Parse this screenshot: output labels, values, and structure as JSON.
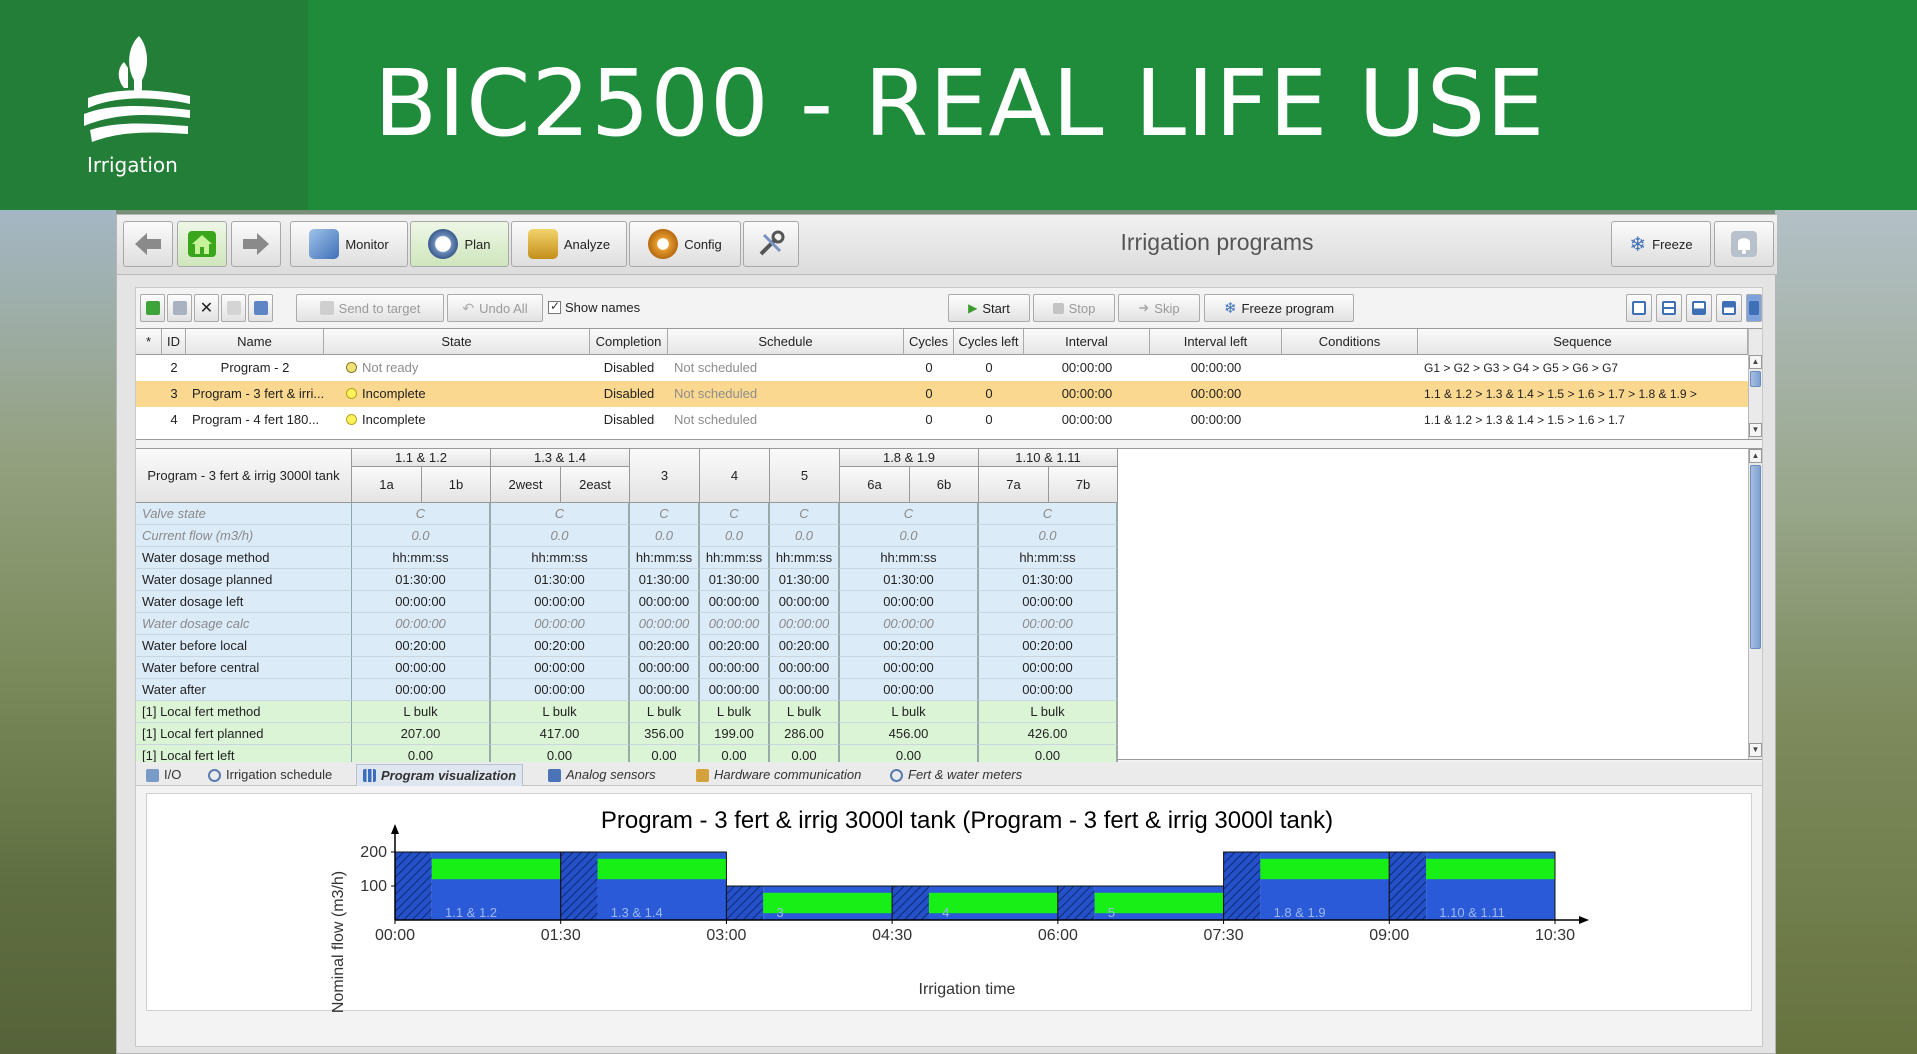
{
  "slide": {
    "title": "BIC2500 - REAL LIFE USE",
    "logo_text": "Irrigation"
  },
  "topbar": {
    "buttons": {
      "monitor": "Monitor",
      "plan": "Plan",
      "analyze": "Analyze",
      "config": "Config"
    },
    "page_title": "Irrigation programs",
    "freeze": "Freeze"
  },
  "toolbar": {
    "send_to_target": "Send to target",
    "undo_all": "Undo All",
    "show_names": "Show names",
    "start": "Start",
    "stop": "Stop",
    "skip": "Skip",
    "freeze_program": "Freeze program"
  },
  "programs": {
    "columns": [
      "*",
      "ID",
      "Name",
      "State",
      "Completion",
      "Schedule",
      "Cycles",
      "Cycles left",
      "Interval",
      "Interval left",
      "Conditions",
      "Sequence"
    ],
    "rows": [
      {
        "id": "2",
        "name": "Program - 2",
        "state": "Not ready",
        "completion": "Disabled",
        "schedule": "Not scheduled",
        "cycles": "0",
        "cycles_left": "0",
        "interval": "00:00:00",
        "interval_left": "00:00:00",
        "conditions": "",
        "sequence": "G1 > G2 > G3 > G4 > G5 > G6 > G7",
        "selected": false
      },
      {
        "id": "3",
        "name": "Program - 3 fert & irri...",
        "state": "Incomplete",
        "completion": "Disabled",
        "schedule": "Not scheduled",
        "cycles": "0",
        "cycles_left": "0",
        "interval": "00:00:00",
        "interval_left": "00:00:00",
        "conditions": "",
        "sequence": "1.1 & 1.2 > 1.3 & 1.4 > 1.5 > 1.6 > 1.7 > 1.8 & 1.9 >",
        "selected": true
      },
      {
        "id": "4",
        "name": "Program - 4 fert 180...",
        "state": "Incomplete",
        "completion": "Disabled",
        "schedule": "Not scheduled",
        "cycles": "0",
        "cycles_left": "0",
        "interval": "00:00:00",
        "interval_left": "00:00:00",
        "conditions": "",
        "sequence": "1.1 & 1.2 > 1.3 & 1.4 > 1.5 > 1.6 > 1.7",
        "selected": false
      }
    ]
  },
  "valve_grid": {
    "program_label": "Program - 3 fert & irrig 3000l tank",
    "groups": [
      "1.1 & 1.2",
      "1.3 & 1.4",
      "3",
      "4",
      "5",
      "1.8 & 1.9",
      "1.10 & 1.11"
    ],
    "subs": [
      "1a",
      "1b",
      "2west",
      "2east",
      "6a",
      "6b",
      "7a",
      "7b"
    ],
    "rows": [
      {
        "label": "Valve state",
        "values": [
          "C",
          "C",
          "C",
          "C",
          "C",
          "C",
          "C"
        ],
        "style": "blue",
        "italic": true
      },
      {
        "label": "Current flow (m3/h)",
        "values": [
          "0.0",
          "0.0",
          "0.0",
          "0.0",
          "0.0",
          "0.0",
          "0.0"
        ],
        "style": "blue",
        "italic": true
      },
      {
        "label": "Water dosage method",
        "values": [
          "hh:mm:ss",
          "hh:mm:ss",
          "hh:mm:ss",
          "hh:mm:ss",
          "hh:mm:ss",
          "hh:mm:ss",
          "hh:mm:ss"
        ],
        "style": "blue",
        "italic": false
      },
      {
        "label": "Water dosage planned",
        "values": [
          "01:30:00",
          "01:30:00",
          "01:30:00",
          "01:30:00",
          "01:30:00",
          "01:30:00",
          "01:30:00"
        ],
        "style": "blue",
        "italic": false
      },
      {
        "label": "Water dosage left",
        "values": [
          "00:00:00",
          "00:00:00",
          "00:00:00",
          "00:00:00",
          "00:00:00",
          "00:00:00",
          "00:00:00"
        ],
        "style": "blue",
        "italic": false
      },
      {
        "label": "Water dosage calc",
        "values": [
          "00:00:00",
          "00:00:00",
          "00:00:00",
          "00:00:00",
          "00:00:00",
          "00:00:00",
          "00:00:00"
        ],
        "style": "blue",
        "italic": true
      },
      {
        "label": "Water before local",
        "values": [
          "00:20:00",
          "00:20:00",
          "00:20:00",
          "00:20:00",
          "00:20:00",
          "00:20:00",
          "00:20:00"
        ],
        "style": "blue",
        "italic": false
      },
      {
        "label": "Water before central",
        "values": [
          "00:00:00",
          "00:00:00",
          "00:00:00",
          "00:00:00",
          "00:00:00",
          "00:00:00",
          "00:00:00"
        ],
        "style": "blue",
        "italic": false
      },
      {
        "label": "Water after",
        "values": [
          "00:00:00",
          "00:00:00",
          "00:00:00",
          "00:00:00",
          "00:00:00",
          "00:00:00",
          "00:00:00"
        ],
        "style": "blue",
        "italic": false
      },
      {
        "label": "[1]   Local fert method",
        "values": [
          "L bulk",
          "L bulk",
          "L bulk",
          "L bulk",
          "L bulk",
          "L bulk",
          "L bulk"
        ],
        "style": "green",
        "italic": false
      },
      {
        "label": "[1]   Local fert planned",
        "values": [
          "207.00",
          "417.00",
          "356.00",
          "199.00",
          "286.00",
          "456.00",
          "426.00"
        ],
        "style": "green",
        "italic": false
      },
      {
        "label": "[1]   Local fert left",
        "values": [
          "0.00",
          "0.00",
          "0.00",
          "0.00",
          "0.00",
          "0.00",
          "0.00"
        ],
        "style": "green",
        "italic": false
      }
    ]
  },
  "tabs": [
    "I/O",
    "Irrigation schedule",
    "Program visualization",
    "Analog sensors",
    "Hardware communication",
    "Fert & water meters"
  ],
  "active_tab": 2,
  "colors": {
    "banner": "#1e8c3a",
    "selected_row": "#fbd88f",
    "flow_blue": "#2a5ad8",
    "fert_green": "#17ef17"
  },
  "chart_data": {
    "type": "area",
    "title": "Program - 3 fert & irrig 3000l tank (Program - 3 fert & irrig 3000l tank)",
    "xlabel": "Irrigation time",
    "ylabel": "Nominal flow (m3/h)",
    "x_ticks": [
      "00:00",
      "01:30",
      "03:00",
      "04:30",
      "06:00",
      "07:30",
      "09:00",
      "10:30"
    ],
    "y_ticks": [
      100,
      200
    ],
    "xlim_hours": [
      0,
      10.5
    ],
    "ylim": [
      0,
      200
    ],
    "blocks": [
      {
        "label": "1.1 & 1.2",
        "start_h": 0,
        "end_h": 1.5,
        "flow": 200,
        "fert_low": 120,
        "fert_high": 180
      },
      {
        "label": "1.3 & 1.4",
        "start_h": 1.5,
        "end_h": 3.0,
        "flow": 200,
        "fert_low": 120,
        "fert_high": 180
      },
      {
        "label": "3",
        "start_h": 3.0,
        "end_h": 4.5,
        "flow": 100,
        "fert_low": 20,
        "fert_high": 80
      },
      {
        "label": "4",
        "start_h": 4.5,
        "end_h": 6.0,
        "flow": 100,
        "fert_low": 20,
        "fert_high": 80
      },
      {
        "label": "5",
        "start_h": 6.0,
        "end_h": 7.5,
        "flow": 100,
        "fert_low": 20,
        "fert_high": 80
      },
      {
        "label": "1.8 & 1.9",
        "start_h": 7.5,
        "end_h": 9.0,
        "flow": 200,
        "fert_low": 120,
        "fert_high": 180
      },
      {
        "label": "1.10 & 1.11",
        "start_h": 9.0,
        "end_h": 10.5,
        "flow": 200,
        "fert_low": 120,
        "fert_high": 180
      }
    ],
    "pre_water_h": 0.3333
  }
}
